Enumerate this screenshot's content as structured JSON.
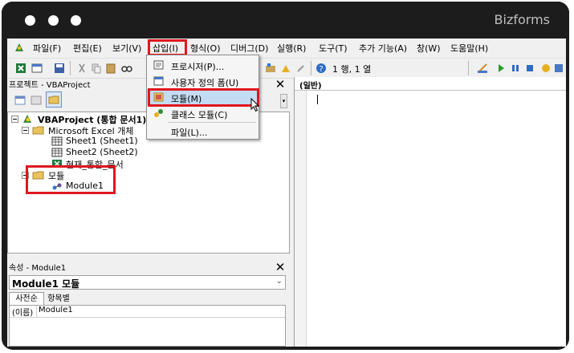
{
  "window": {
    "brand": "Bizforms"
  },
  "menu": {
    "items": [
      "파일(F)",
      "편집(E)",
      "보기(V)",
      "삽입(I)",
      "형식(O)",
      "디버그(D)",
      "실행(R)",
      "도구(T)",
      "추가 기능(A)",
      "창(W)",
      "도움말(H)"
    ]
  },
  "toolbar": {
    "position_text": "1 행, 1 열"
  },
  "insert_menu": {
    "items": [
      "프로시저(P)...",
      "사용자 정의 폼(U)",
      "모듈(M)",
      "클래스 모듈(C)",
      "파일(L)..."
    ],
    "highlighted": "모듈(M)"
  },
  "project_panel": {
    "title": "프로젝트 - VBAProject",
    "tree": {
      "root": "VBAProject (통합 문서1)",
      "excel_folder": "Microsoft Excel 개체",
      "sheet1": "Sheet1 (Sheet1)",
      "sheet2": "Sheet2 (Sheet2)",
      "workbook": "현재_통합_문서",
      "module_folder": "모듈",
      "module1": "Module1"
    }
  },
  "properties_panel": {
    "title": "속성 - Module1",
    "object": "Module1 모듈",
    "tabs": [
      "사전순",
      "항목별"
    ],
    "row_name": "(이름)",
    "row_value": "Module1"
  },
  "code_window": {
    "object_combo": "(일반)"
  },
  "colors": {
    "highlight_red": "#e0161f",
    "menu_highlight": "#c4dcf3"
  }
}
